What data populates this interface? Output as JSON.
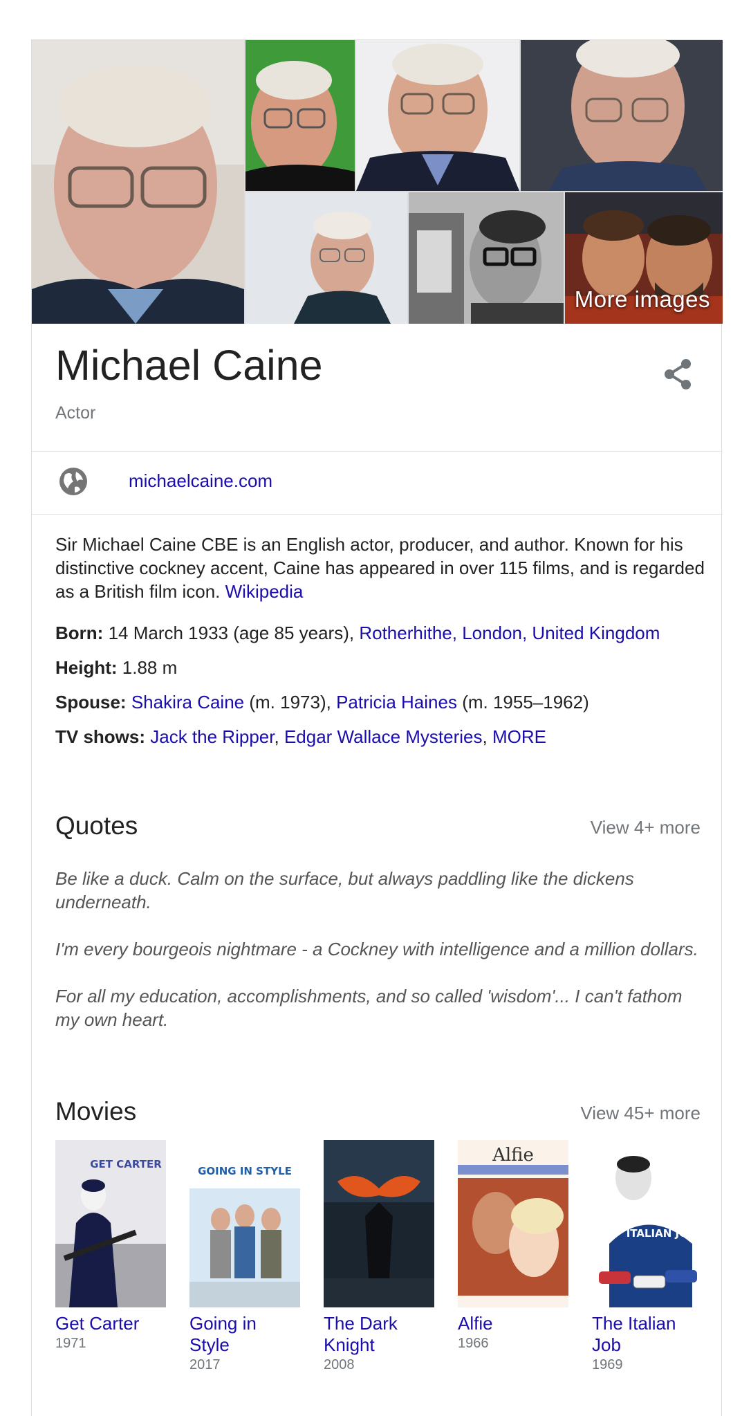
{
  "gallery": {
    "more_images_label": "More images"
  },
  "person": {
    "name": "Michael Caine",
    "role": "Actor",
    "website": "michaelcaine.com",
    "description": "Sir Michael Caine CBE is an English actor, producer, and author. Known for his distinctive cockney accent, Caine has appeared in over 115 films, and is regarded as a British film icon.",
    "description_source": "Wikipedia"
  },
  "facts": {
    "born": {
      "label": "Born:",
      "text": "14 March 1933 (age 85 years),",
      "link": "Rotherhithe, London, United Kingdom"
    },
    "height": {
      "label": "Height:",
      "text": "1.88 m"
    },
    "spouse": {
      "label": "Spouse:",
      "spouse1": "Shakira Caine",
      "spouse1_years": "(m. 1973),",
      "spouse2": "Patricia Haines",
      "spouse2_years": "(m. 1955–1962)"
    },
    "tv_shows": {
      "label": "TV shows:",
      "show1": "Jack the Ripper",
      "sep1": ",",
      "show2": "Edgar Wallace Mysteries",
      "sep2": ",",
      "more": "MORE"
    }
  },
  "quotes": {
    "title": "Quotes",
    "view_more": "View 4+ more",
    "items": [
      "Be like a duck. Calm on the surface, but always paddling like the dickens underneath.",
      "I'm every bourgeois nightmare - a Cockney with intelligence and a million dollars.",
      "For all my education, accomplishments, and so called 'wisdom'... I can't fathom my own heart."
    ]
  },
  "movies": {
    "title": "Movies",
    "view_more": "View 45+ more",
    "items": [
      {
        "title": "Get Carter",
        "year": "1971",
        "poster_text": "GET CARTER"
      },
      {
        "title": "Going in Style",
        "year": "2017",
        "poster_text": "GOING IN STYLE"
      },
      {
        "title": "The Dark Knight",
        "year": "2008",
        "poster_text": ""
      },
      {
        "title": "Alfie",
        "year": "1966",
        "poster_text": "Alfie"
      },
      {
        "title": "The Italian Job",
        "year": "1969",
        "poster_text": "ITALIAN JOB"
      }
    ]
  },
  "colors": {
    "link": "#1a0dab",
    "muted": "#70757a",
    "text": "#222222"
  },
  "icons": {
    "share": "share-icon",
    "website": "globe-icon"
  }
}
